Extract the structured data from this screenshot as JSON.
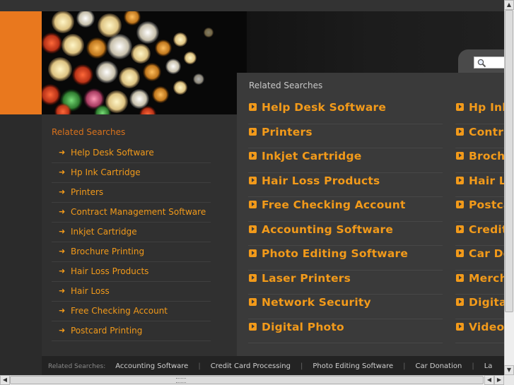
{
  "sidebar": {
    "title": "Related Searches",
    "items": [
      "Help Desk Software",
      "Hp Ink Cartridge",
      "Printers",
      "Contract Management Software",
      "Inkjet Cartridge",
      "Brochure Printing",
      "Hair Loss Products",
      "Hair Loss",
      "Free Checking Account",
      "Postcard Printing"
    ]
  },
  "main": {
    "title": "Related Searches",
    "col1": [
      "Help Desk Software",
      "Printers",
      "Inkjet Cartridge",
      "Hair Loss Products",
      "Free Checking Account",
      "Accounting Software",
      "Photo Editing Software",
      "Laser Printers",
      "Network Security",
      "Digital Photo"
    ],
    "col2": [
      "Hp Ink",
      "Contra",
      "Brochu",
      "Hair Lo",
      "Postca",
      "Credit",
      "Car Do",
      "Merch",
      "Digital",
      "Video"
    ]
  },
  "footer": {
    "label": "Related Searches:",
    "links": [
      "Accounting Software",
      "Credit Card Processing",
      "Photo Editing Software",
      "Car Donation",
      "La"
    ]
  },
  "icons": {
    "search": "search-icon",
    "arrow": "arrow-right-icon",
    "bullet": "orange-square-arrow-icon"
  },
  "colors": {
    "accent": "#f29a1a",
    "orange_block": "#e9781e",
    "background": "#2b2b2b"
  }
}
